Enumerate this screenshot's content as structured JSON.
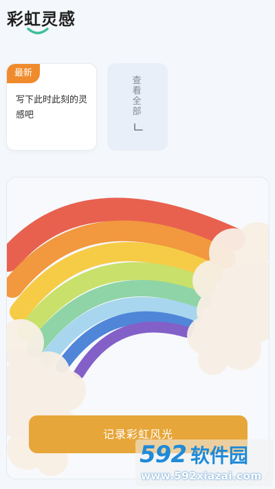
{
  "header": {
    "title": "彩虹灵感"
  },
  "newest_card": {
    "badge": "最新",
    "text": "写下此时此刻的灵感吧"
  },
  "view_all": {
    "label": "查看全部"
  },
  "main": {
    "button_label": "记录彩虹风光"
  },
  "watermark": {
    "brand_number": "592",
    "brand_text": "软件园",
    "url": "www.592xiazai.com"
  },
  "colors": {
    "accent": "#e7a63a",
    "badge": "#ef8b2c",
    "underline": "#3fbf9a",
    "rainbow": [
      "#e8614f",
      "#f2983e",
      "#f6cc47",
      "#c9e06a",
      "#8fd4a6",
      "#a7d6ee",
      "#4f86d8",
      "#8360c8"
    ]
  },
  "icons": {
    "view_all_arrow": "arrow-corner-icon",
    "title_decoration": "smile-underline-icon"
  }
}
